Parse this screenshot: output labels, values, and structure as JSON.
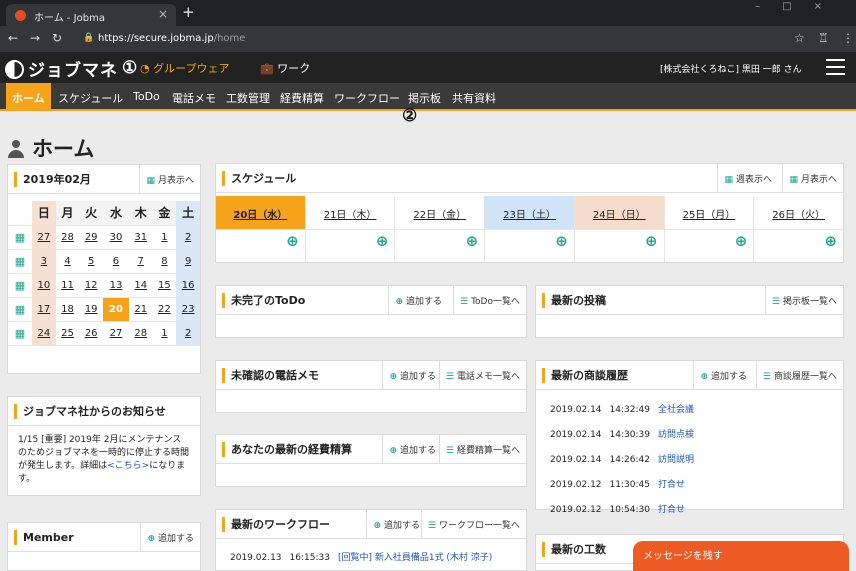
{
  "browser": {
    "tab_title": "ホーム - Jobma",
    "url_host": "https://secure.jobma.jp",
    "url_path": "/home"
  },
  "header": {
    "logo": "ジョブマネ",
    "groupware": "グループウェア",
    "work": "ワーク",
    "company": "[株式会社くろねこ] 黒田 一郎 さん",
    "badge1": "①",
    "badge2": "②"
  },
  "menu": [
    "ホーム",
    "スケジュール",
    "ToDo",
    "電話メモ",
    "工数管理",
    "経費精算",
    "ワークフロー",
    "掲示板",
    "共有資料"
  ],
  "page_title": "ホーム",
  "calendar": {
    "title": "2019年02月",
    "btn": "月表示へ",
    "weekdays": [
      "日",
      "月",
      "火",
      "水",
      "木",
      "金",
      "土"
    ],
    "weeks": [
      [
        "27",
        "28",
        "29",
        "30",
        "31",
        "1",
        "2"
      ],
      [
        "3",
        "4",
        "5",
        "6",
        "7",
        "8",
        "9"
      ],
      [
        "10",
        "11",
        "12",
        "13",
        "14",
        "15",
        "16"
      ],
      [
        "17",
        "18",
        "19",
        "20",
        "21",
        "22",
        "23"
      ],
      [
        "24",
        "25",
        "26",
        "27",
        "28",
        "1",
        "2"
      ]
    ],
    "today": "20"
  },
  "notice": {
    "title": "ジョブマネ社からのお知らせ",
    "text1": "1/15 [重要] 2019年 2月にメンテナンスのためジョブマネを一時的に停止する時間が発生します。詳細は",
    "link": "<こちら>",
    "text2": "になります。"
  },
  "member": {
    "title": "Member",
    "add": "追加する"
  },
  "schedule": {
    "title": "スケジュール",
    "week_btn": "週表示へ",
    "month_btn": "月表示へ",
    "days": [
      "20日（水）",
      "21日（木）",
      "22日（金）",
      "23日（土）",
      "24日（日）",
      "25日（月）",
      "26日（火）"
    ]
  },
  "todo": {
    "title": "未完了のToDo",
    "add": "追加する",
    "list": "ToDo一覧へ"
  },
  "phone": {
    "title": "未確認の電話メモ",
    "add": "追加する",
    "list": "電話メモ一覧へ"
  },
  "expense": {
    "title": "あなたの最新の経費精算",
    "add": "追加する",
    "list": "経費精算一覧へ"
  },
  "workflow": {
    "title": "最新のワークフロー",
    "add": "追加する",
    "list": "ワークフロー一覧へ",
    "rows": [
      {
        "date": "2019.02.13",
        "time": "16:15:33",
        "link": "[回覧中] 新入社員備品1式 (木村 涼子)"
      }
    ]
  },
  "posts": {
    "title": "最新の投稿",
    "list": "掲示板一覧へ"
  },
  "deals": {
    "title": "最新の商談履歴",
    "add": "追加する",
    "list": "商談履歴一覧へ",
    "rows": [
      {
        "date": "2019.02.14",
        "time": "14:32:49",
        "link": "全社会議"
      },
      {
        "date": "2019.02.14",
        "time": "14:30:39",
        "link": "訪問点検"
      },
      {
        "date": "2019.02.14",
        "time": "14:26:42",
        "link": "訪問説明"
      },
      {
        "date": "2019.02.12",
        "time": "11:30:45",
        "link": "打合せ"
      },
      {
        "date": "2019.02.12",
        "time": "10:54:30",
        "link": "打合せ"
      }
    ]
  },
  "workhours": {
    "title": "最新の工数"
  },
  "message_btn": "メッセージを残す",
  "colors": {
    "accent": "#f4a31a",
    "teal": "#1aa68c",
    "message": "#ee5a24"
  }
}
